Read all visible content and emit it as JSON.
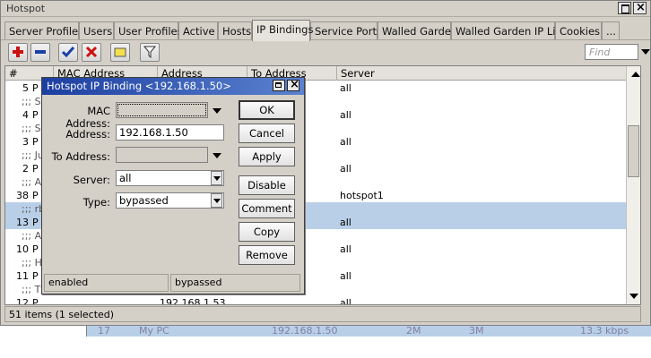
{
  "window": {
    "title": "Hotspot"
  },
  "tabs": [
    {
      "label": "Server Profiles"
    },
    {
      "label": "Users"
    },
    {
      "label": "User Profiles"
    },
    {
      "label": "Active"
    },
    {
      "label": "Hosts"
    },
    {
      "label": "IP Bindings",
      "active": true
    },
    {
      "label": "Service Ports"
    },
    {
      "label": "Walled Garden"
    },
    {
      "label": "Walled Garden IP List"
    },
    {
      "label": "Cookies"
    },
    {
      "label": "..."
    }
  ],
  "toolbar": {
    "find_placeholder": "Find"
  },
  "table": {
    "columns": [
      "#",
      "MAC Address",
      "Address",
      "To Address",
      "Server"
    ],
    "rows": [
      {
        "num": "5",
        "flag": "P",
        "server": "all"
      },
      {
        "comment": ";;; Se"
      },
      {
        "num": "4",
        "flag": "P",
        "server": "all"
      },
      {
        "comment": ";;; Se"
      },
      {
        "num": "3",
        "flag": "P",
        "server": "all"
      },
      {
        "comment": ";;; Ju"
      },
      {
        "num": "2",
        "flag": "P",
        "server": "all"
      },
      {
        "comment": ";;; Af"
      },
      {
        "num": "38",
        "flag": "P",
        "toaddr": "0",
        "server": "hotspot1"
      },
      {
        "comment": ";;; rb",
        "selected": true
      },
      {
        "num": "13",
        "flag": "P",
        "server": "all",
        "selected": true
      },
      {
        "comment": ";;; AF"
      },
      {
        "num": "10",
        "flag": "P",
        "server": "all"
      },
      {
        "comment": ";;; HI"
      },
      {
        "num": "11",
        "flag": "P",
        "server": "all"
      },
      {
        "comment": ";;; Tf"
      },
      {
        "num": "12",
        "flag": "P",
        "address": "192.168.1.53",
        "server": "all"
      }
    ]
  },
  "status": {
    "text": "51 items (1 selected)"
  },
  "background_row": {
    "num": "17",
    "name": "My PC",
    "address": "192.168.1.50",
    "c1": "2M",
    "c2": "3M",
    "rate": "13.3 kbps"
  },
  "dialog": {
    "title": "Hotspot IP Binding <192.168.1.50>",
    "mac_label": "MAC Address:",
    "mac_value": "",
    "address_label": "Address:",
    "address_value": "192.168.1.50",
    "to_address_label": "To Address:",
    "to_address_value": "",
    "server_label": "Server:",
    "server_value": "all",
    "type_label": "Type:",
    "type_value": "bypassed",
    "buttons": {
      "ok": "OK",
      "cancel": "Cancel",
      "apply": "Apply",
      "disable": "Disable",
      "comment": "Comment",
      "copy": "Copy",
      "remove": "Remove"
    },
    "status_left": "enabled",
    "status_right": "bypassed"
  },
  "colors": {
    "selection": "#b9cfe8",
    "title_gradient_start": "#1c3fa0",
    "title_gradient_end": "#5b82d0",
    "add": "#cc1010",
    "remove": "#1a3fa8"
  }
}
